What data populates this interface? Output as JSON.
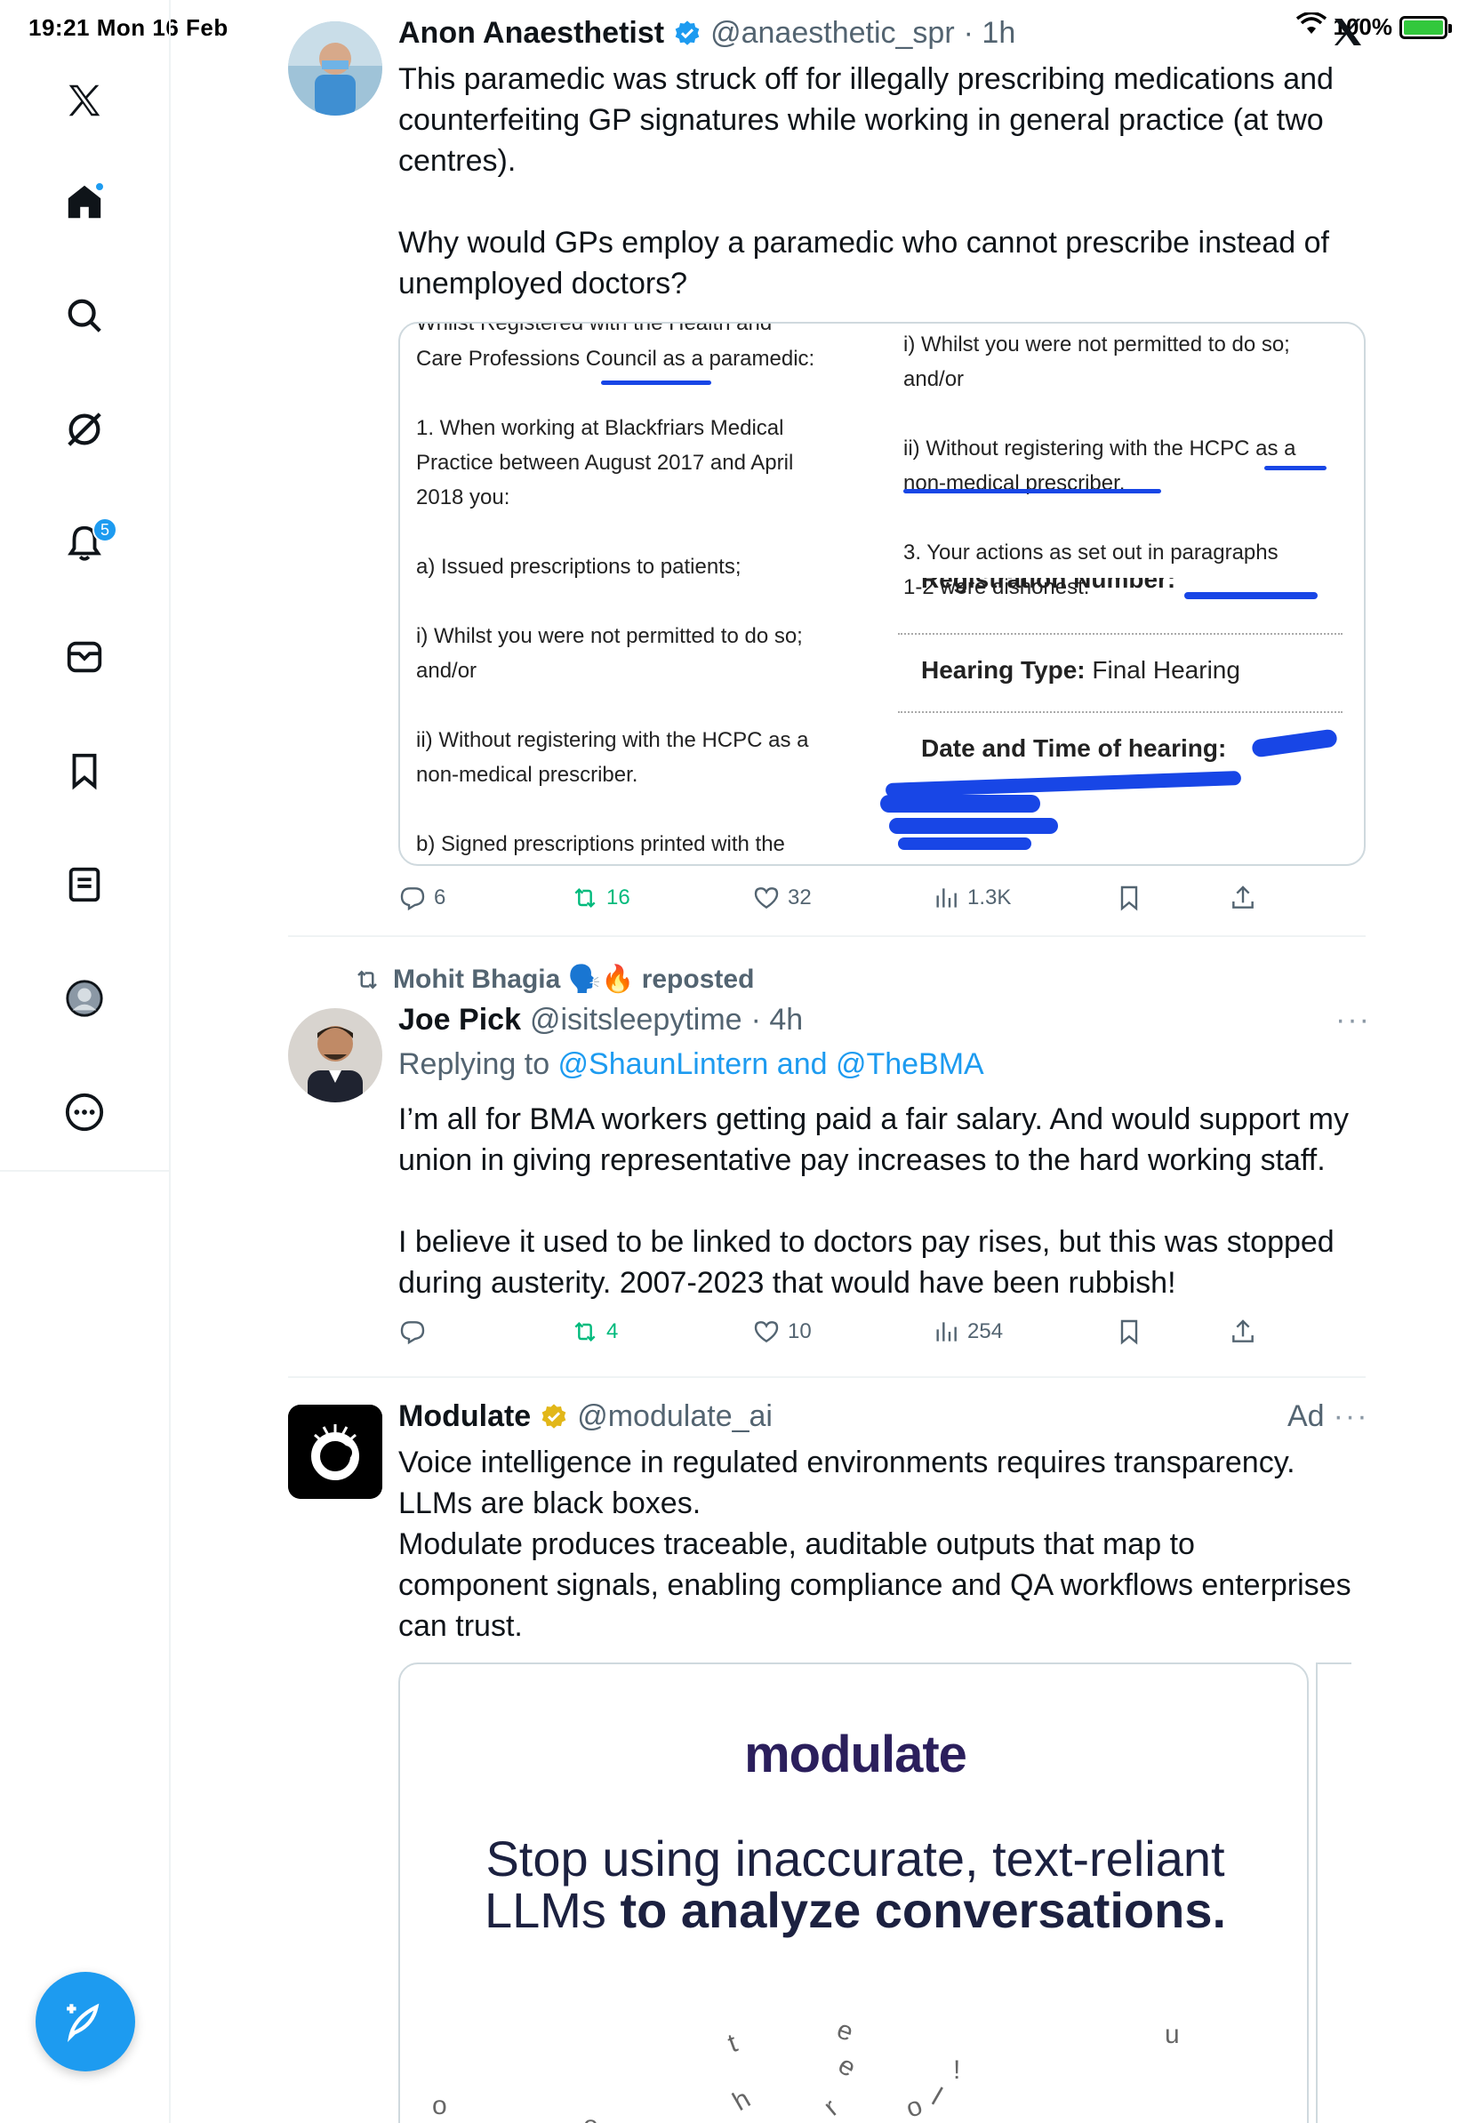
{
  "status_bar": {
    "time_date": "19:21  Mon 16 Feb",
    "battery": "100%"
  },
  "sidebar": {
    "items": [
      {
        "name": "x-logo-icon"
      },
      {
        "name": "home-icon"
      },
      {
        "name": "search-icon"
      },
      {
        "name": "grok-icon"
      },
      {
        "name": "notifications-icon",
        "badge": "5"
      },
      {
        "name": "messages-icon"
      },
      {
        "name": "bookmarks-icon"
      },
      {
        "name": "lists-icon"
      },
      {
        "name": "profile-icon"
      },
      {
        "name": "more-icon"
      }
    ],
    "compose": "compose-icon"
  },
  "tweets": [
    {
      "author": "Anon Anaesthetist",
      "handle": "@anaesthetic_spr",
      "time": "· 1h",
      "text": "This paramedic was struck off for illegally prescribing medications and\ncounterfeiting GP signatures while working in general practice (at two\ncentres).\n\nWhy would GPs employ a paramedic who cannot prescribe instead of\nunemployed doctors?",
      "image": {
        "left_top": "Whilst Registered with the Health and",
        "left_text": "Care Professions Council as a paramedic:\n\n1. When working at Blackfriars Medical\nPractice between August 2017 and April\n2018 you:\n\na) Issued prescriptions to patients;\n\ni) Whilst you were not permitted to do so;\nand/or\n\nii) Without registering with the HCPC as a\nnon-medical prescriber.\n\nb) Signed prescriptions printed with the\nGP’s details which you were not permitted\nto do.",
        "right_text": "i) Whilst you were not permitted to do so;\nand/or\n\nii) Without registering with the HCPC as a\nnon-medical prescriber.\n\n3. Your actions as set out in paragraphs\n1-2 were dishonest.",
        "field_registration": "Registration Number:",
        "field_hearing_label": "Hearing Type:",
        "field_hearing_value": " Final Hearing",
        "field_date_label": "Date and Time of hearing:"
      },
      "replies": "6",
      "reposts": "16",
      "likes": "32",
      "views": "1.3K"
    },
    {
      "reposted_by": "Mohit Bhagia 🗣️🔥 reposted",
      "author": "Joe Pick",
      "handle": "@isitsleepytime",
      "time": "· 4h",
      "replying_prefix": "Replying to ",
      "replying_to": "@ShaunLintern and @TheBMA",
      "text": "I’m all for BMA workers getting paid a fair salary. And would support my\nunion in giving representative pay increases to the hard working staff.\n\nI believe it used to be linked to doctors pay rises, but this was stopped\nduring austerity. 2007-2023 that would have been rubbish!",
      "replies": "",
      "reposts": "4",
      "likes": "10",
      "views": "254"
    },
    {
      "author": "Modulate",
      "handle": "@modulate_ai",
      "ad_label": "Ad",
      "text": "Voice intelligence in regulated environments requires transparency.\nLLMs are black boxes.\nModulate produces traceable, auditable outputs that map to\ncomponent signals, enabling compliance and QA workflows enterprises\ncan trust.",
      "card_logo": "modulate",
      "card_headline_1": "Stop using inaccurate, text-reliant",
      "card_headline_2a": "LLMs ",
      "card_headline_2b": "to analyze conversations."
    }
  ],
  "colors": {
    "accent": "#1d9bf0",
    "repost_green": "#00ba7c",
    "muted": "#536471"
  }
}
